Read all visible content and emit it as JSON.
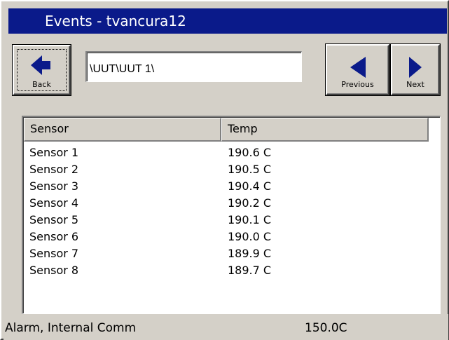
{
  "window": {
    "title": "Events - tvancura12"
  },
  "toolbar": {
    "back_label": "Back",
    "back_icon": "arrow-left-icon",
    "path_value": "\\UUT\\UUT 1\\",
    "previous_label": "Previous",
    "previous_icon": "triangle-left-icon",
    "next_label": "Next",
    "next_icon": "triangle-right-icon"
  },
  "table": {
    "columns": [
      "Sensor",
      "Temp"
    ],
    "rows": [
      {
        "sensor": "Sensor 1",
        "temp": "190.6 C"
      },
      {
        "sensor": "Sensor 2",
        "temp": "190.5 C"
      },
      {
        "sensor": "Sensor 3",
        "temp": "190.4 C"
      },
      {
        "sensor": "Sensor 4",
        "temp": "190.2 C"
      },
      {
        "sensor": "Sensor 5",
        "temp": "190.1 C"
      },
      {
        "sensor": "Sensor 6",
        "temp": "190.0 C"
      },
      {
        "sensor": "Sensor 7",
        "temp": "189.9 C"
      },
      {
        "sensor": "Sensor 8",
        "temp": "189.7 C"
      }
    ]
  },
  "status": {
    "message": "Alarm, Internal Comm",
    "temperature": "150.0C"
  },
  "colors": {
    "title_bar": "#0a1a8a",
    "face": "#d4d0c8",
    "icon": "#0a1a8a"
  }
}
